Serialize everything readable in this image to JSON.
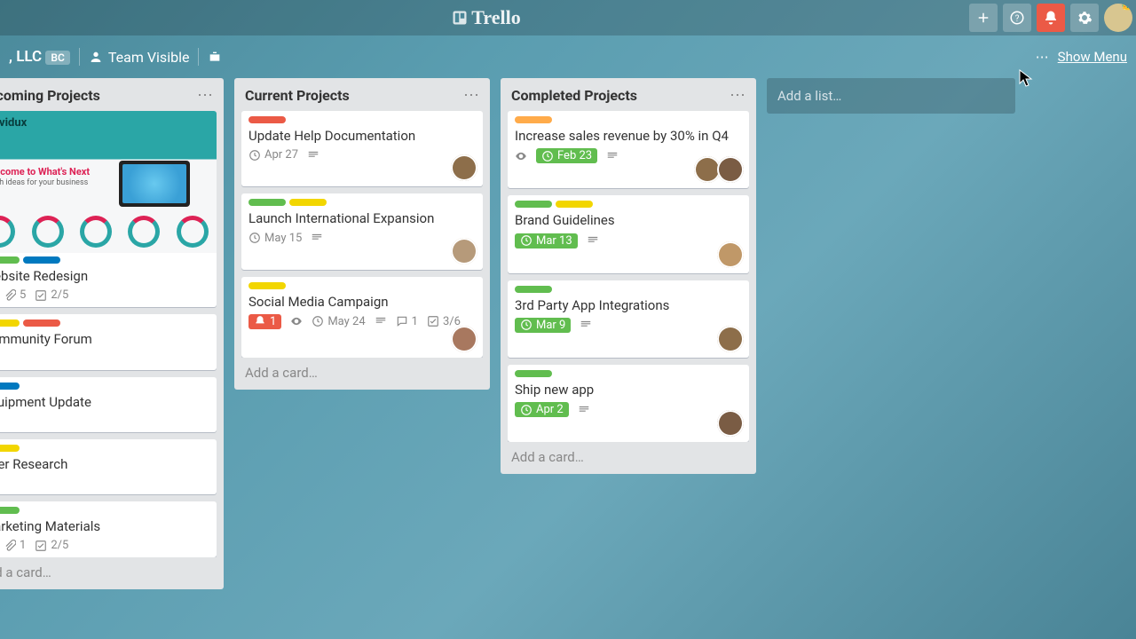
{
  "brand": "Trello",
  "header_buttons": {
    "plus": "+",
    "help": "?",
    "alert": "!",
    "settings": "⚙"
  },
  "board": {
    "team_suffix": ", LLC",
    "bc_badge": "BC",
    "visibility": "Team Visible",
    "show_menu": "Show Menu"
  },
  "lists": [
    {
      "title": "Upcoming Projects",
      "cards": [
        {
          "cover": true,
          "cover_brand": "Travidux",
          "cover_hero": "Welcome to What's Next",
          "cover_sub": "Fresh ideas for your business",
          "labels": [
            "green",
            "blue"
          ],
          "title": "Website Redesign",
          "badges": [
            {
              "t": "desc"
            },
            {
              "t": "attach",
              "v": "5"
            },
            {
              "t": "check",
              "v": "2/5"
            }
          ]
        },
        {
          "labels": [
            "yellow",
            "red"
          ],
          "title": "Community Forum",
          "badges": [
            {
              "t": "desc"
            }
          ]
        },
        {
          "labels": [
            "blue"
          ],
          "title": "Equipment Update",
          "badges": [
            {
              "t": "desc"
            }
          ]
        },
        {
          "labels": [
            "yellow"
          ],
          "title": "User Research",
          "badges": [
            {
              "t": "desc"
            }
          ]
        },
        {
          "labels": [
            "green"
          ],
          "title": "Marketing Materials",
          "badges": [
            {
              "t": "desc"
            },
            {
              "t": "attach",
              "v": "1"
            },
            {
              "t": "check",
              "v": "2/5"
            }
          ]
        }
      ],
      "add": "Add a card…"
    },
    {
      "title": "Current Projects",
      "cards": [
        {
          "labels": [
            "red"
          ],
          "title": "Update Help Documentation",
          "badges": [
            {
              "t": "clock",
              "v": "Apr 27"
            },
            {
              "t": "desc"
            }
          ],
          "members": [
            "m1"
          ]
        },
        {
          "labels": [
            "green",
            "yellow"
          ],
          "title": "Launch International Expansion",
          "badges": [
            {
              "t": "clock",
              "v": "May 15"
            },
            {
              "t": "desc"
            }
          ],
          "members": [
            "m2"
          ]
        },
        {
          "labels": [
            "yellow"
          ],
          "title": "Social Media Campaign",
          "badges": [
            {
              "t": "alert",
              "v": "1"
            },
            {
              "t": "eye"
            },
            {
              "t": "clock",
              "v": "May 24"
            },
            {
              "t": "desc"
            },
            {
              "t": "comment",
              "v": "1"
            },
            {
              "t": "check",
              "v": "3/6"
            }
          ],
          "members": [
            "m3"
          ],
          "tall": true
        }
      ],
      "add": "Add a card…"
    },
    {
      "title": "Completed Projects",
      "cards": [
        {
          "labels": [
            "orange"
          ],
          "title": "Increase sales revenue by 30% in Q4",
          "badges": [
            {
              "t": "eye"
            },
            {
              "t": "due",
              "v": "Feb 23"
            },
            {
              "t": "desc"
            }
          ],
          "members": [
            "m1",
            "m4"
          ]
        },
        {
          "labels": [
            "green",
            "yellow"
          ],
          "title": "Brand Guidelines",
          "badges": [
            {
              "t": "due",
              "v": "Mar 13"
            },
            {
              "t": "desc"
            }
          ],
          "members": [
            "m5"
          ]
        },
        {
          "labels": [
            "green"
          ],
          "title": "3rd Party App Integrations",
          "badges": [
            {
              "t": "due",
              "v": "Mar 9"
            },
            {
              "t": "desc"
            }
          ],
          "members": [
            "m1"
          ]
        },
        {
          "labels": [
            "green"
          ],
          "title": "Ship new app",
          "badges": [
            {
              "t": "due",
              "v": "Apr 2"
            },
            {
              "t": "desc"
            }
          ],
          "members": [
            "m4"
          ]
        }
      ],
      "add": "Add a card…"
    }
  ],
  "add_list": "Add a list…"
}
